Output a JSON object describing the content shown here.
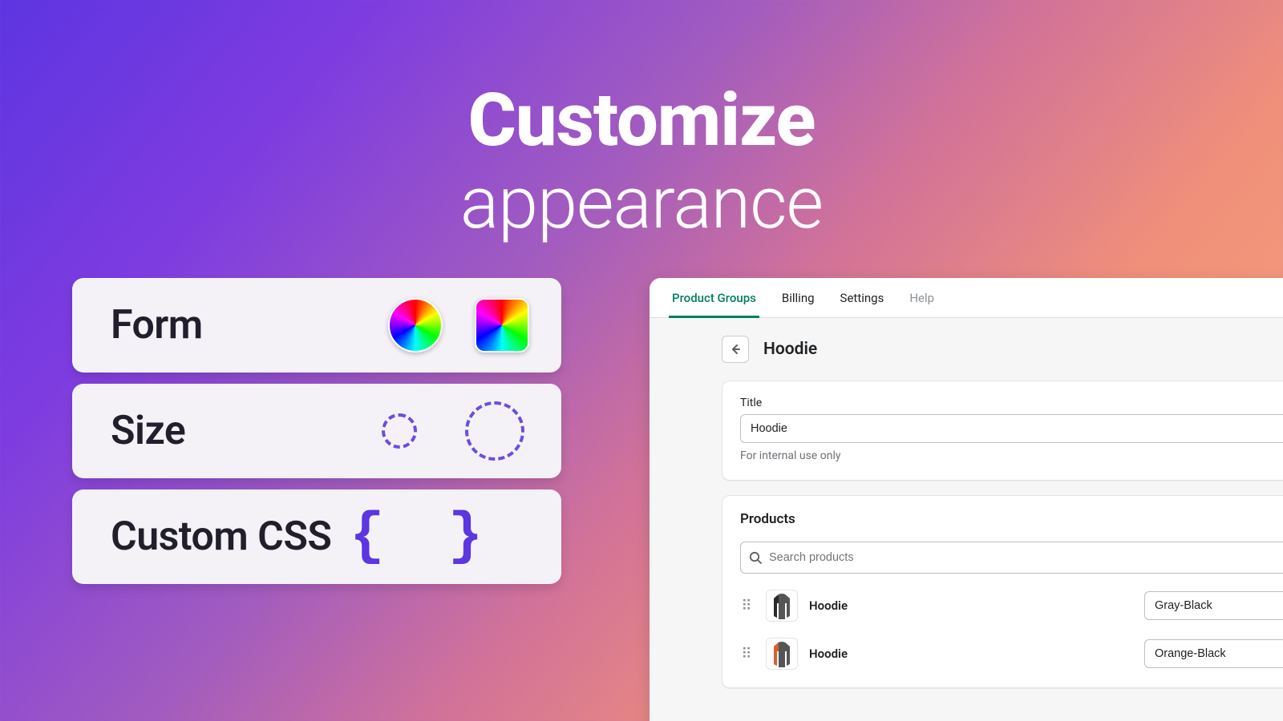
{
  "hero": {
    "title": "Customize",
    "subtitle": "appearance"
  },
  "cards": {
    "form": {
      "label": "Form"
    },
    "size": {
      "label": "Size"
    },
    "css": {
      "label": "Custom CSS",
      "braces": "{ }"
    }
  },
  "app": {
    "tabs": [
      {
        "label": "Product Groups",
        "active": true,
        "muted": false
      },
      {
        "label": "Billing",
        "active": false,
        "muted": false
      },
      {
        "label": "Settings",
        "active": false,
        "muted": false
      },
      {
        "label": "Help",
        "active": false,
        "muted": true
      }
    ],
    "page_title": "Hoodie",
    "title_field": {
      "label": "Title",
      "value": "Hoodie",
      "hint": "For internal use only"
    },
    "products_section": {
      "heading": "Products",
      "search_placeholder": "Search products",
      "rows": [
        {
          "name": "Hoodie",
          "variant": "Gray-Black",
          "accent": "gray"
        },
        {
          "name": "Hoodie",
          "variant": "Orange-Black",
          "accent": "orange"
        }
      ]
    }
  }
}
